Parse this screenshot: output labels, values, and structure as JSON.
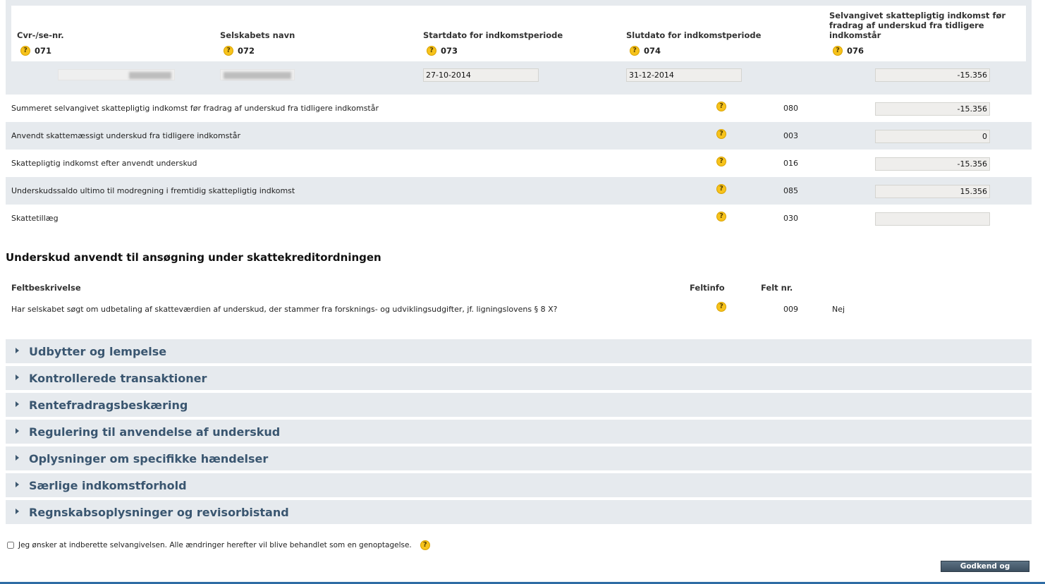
{
  "header": {
    "columns": [
      {
        "label": "Cvr-/se-nr.",
        "number": "071"
      },
      {
        "label": "Selskabets navn",
        "number": "072"
      },
      {
        "label": "Startdato for indkomstperiode",
        "number": "073"
      },
      {
        "label": "Slutdato for indkomstperiode",
        "number": "074"
      },
      {
        "label": "Selvangivet skattepligtig indkomst før fradrag af underskud fra tidligere indkomstår",
        "number": "076"
      }
    ],
    "values": {
      "startdato": "27-10-2014",
      "slutdato": "31-12-2014",
      "indkomst": "-15.356"
    }
  },
  "help_glyph": "?",
  "rows": [
    {
      "desc": "Summeret selvangivet skattepligtig indkomst før fradrag af underskud fra tidligere indkomstår",
      "code": "080",
      "value": "-15.356"
    },
    {
      "desc": "Anvendt skattemæssigt underskud fra tidligere indkomstår",
      "code": "003",
      "value": "0"
    },
    {
      "desc": "Skattepligtig indkomst efter anvendt underskud",
      "code": "016",
      "value": "-15.356"
    },
    {
      "desc": "Underskudssaldo ultimo til modregning i fremtidig skattepligtig indkomst",
      "code": "085",
      "value": "15.356"
    },
    {
      "desc": "Skattetillæg",
      "code": "030",
      "value": ""
    }
  ],
  "credit_section": {
    "title": "Underskud anvendt til ansøgning under skattekreditordningen",
    "col_desc": "Feltbeskrivelse",
    "col_info": "Feltinfo",
    "col_nr": "Felt nr.",
    "question": "Har selskabet søgt om udbetaling af skatteværdien af underskud, der stammer fra forsknings- og udviklingsudgifter, jf. ligningslovens § 8 X?",
    "code": "009",
    "answer": "Nej"
  },
  "accordion": [
    "Udbytter og lempelse",
    "Kontrollerede transaktioner",
    "Rentefradragsbeskæring",
    "Regulering til anvendelse af underskud",
    "Oplysninger om specifikke hændelser",
    "Særlige indkomstforhold",
    "Regnskabsoplysninger og revisorbistand"
  ],
  "consent_text": "Jeg ønsker at indberette selvangivelsen. Alle ændringer herefter vil blive behandlet som en genoptagelse.",
  "submit_label": "Godkend og Indberet",
  "colors": {
    "accent": "#3a5670",
    "band": "#e6eaee",
    "help": "#f7c31c",
    "bottom_line": "#2e6ca4"
  }
}
